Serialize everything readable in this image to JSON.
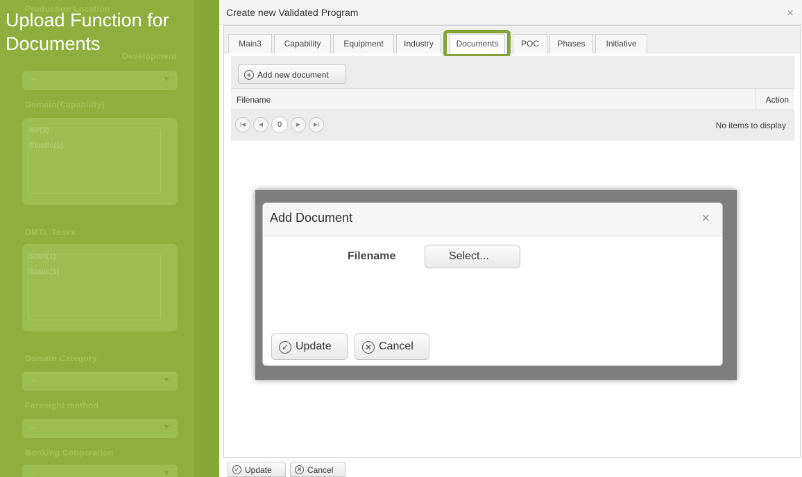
{
  "annotation": {
    "headline": "Upload Function for Documents",
    "ghost_labels": [
      "Production Location",
      "Development",
      "Domain(Capability)",
      "DMTL Tasks",
      "Domain Category",
      "Foresight method",
      "Booking Cooperation"
    ],
    "ghost_tree1": [
      "Air(3)",
      "Elastic(1)"
    ],
    "ghost_tree2": [
      "Start(1)",
      "Static(1)"
    ],
    "ghost_value": "---",
    "brand_color": "#8fae3e"
  },
  "window": {
    "title": "Create new Validated Program",
    "close_icon": "×"
  },
  "tabs": [
    "Main3",
    "Capability",
    "Equipment",
    "Industry",
    "Documents",
    "POC",
    "Phases",
    "Initiative"
  ],
  "active_tab": "Documents",
  "toolbar": {
    "add_icon": "+",
    "add_label": "Add new document"
  },
  "grid": {
    "columns": [
      "Filename",
      "Action"
    ],
    "pager": {
      "first": "|◀",
      "prev": "◀",
      "page": "0",
      "next": "▶",
      "last": "▶|"
    },
    "empty_text": "No items to display"
  },
  "dialog": {
    "title": "Add Document",
    "close_icon": "×",
    "field_label": "Filename",
    "select_label": "Select...",
    "update_label": "Update",
    "cancel_label": "Cancel",
    "update_icon": "✓",
    "cancel_icon": "✕"
  },
  "footer": {
    "update_label": "Update",
    "cancel_label": "Cancel",
    "update_icon": "✓",
    "cancel_icon": "✕"
  }
}
